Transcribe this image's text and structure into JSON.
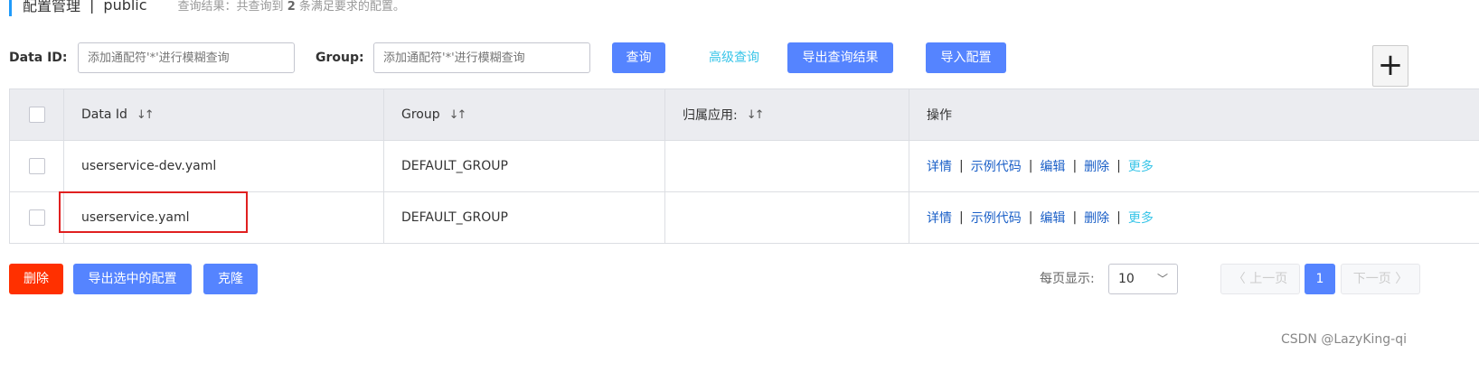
{
  "header": {
    "title": "配置管理",
    "separator": "|",
    "namespace": "public",
    "result_prefix": "查询结果：共查询到",
    "result_count": "2",
    "result_suffix": "条满足要求的配置。"
  },
  "search": {
    "data_id_label": "Data ID:",
    "data_id_placeholder": "添加通配符'*'进行模糊查询",
    "group_label": "Group:",
    "group_placeholder": "添加通配符'*'进行模糊查询",
    "query_button": "查询",
    "advanced_query": "高级查询",
    "export_results_button": "导出查询结果",
    "import_button": "导入配置",
    "add_icon": "plus-icon"
  },
  "table": {
    "columns": [
      "Data Id",
      "Group",
      "归属应用:",
      "操作"
    ],
    "sort_glyph": "↓↑",
    "rows": [
      {
        "data_id": "userservice-dev.yaml",
        "group": "DEFAULT_GROUP",
        "app": ""
      },
      {
        "data_id": "userservice.yaml",
        "group": "DEFAULT_GROUP",
        "app": ""
      }
    ],
    "actions": {
      "detail": "详情",
      "sample_code": "示例代码",
      "edit": "编辑",
      "delete": "删除",
      "more": "更多",
      "sep": "|"
    }
  },
  "footer": {
    "delete_button": "删除",
    "export_selected_button": "导出选中的配置",
    "clone_button": "克隆",
    "page_size_label": "每页显示:",
    "page_size_value": "10",
    "prev_label": "〈 上一页",
    "current_page": "1",
    "next_label": "下一页 〉"
  },
  "watermark": "CSDN @LazyKing-qi",
  "colors": {
    "primary": "#5584ff",
    "danger": "#ff3000",
    "link": "#1a5fc7",
    "accent_link": "#39c5e8",
    "highlight": "#e02020"
  }
}
